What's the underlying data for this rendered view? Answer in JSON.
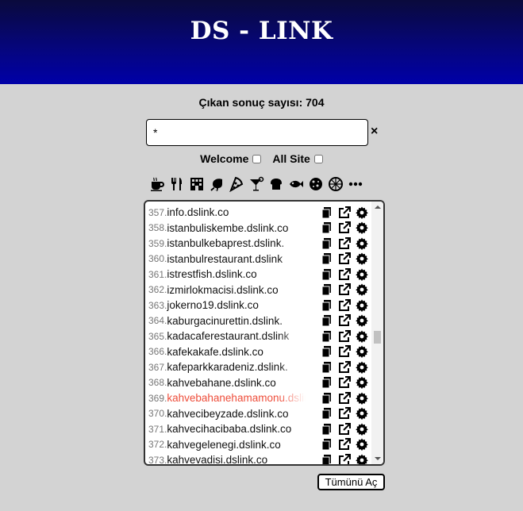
{
  "header": {
    "title": "DS - LINK"
  },
  "results": {
    "count_label": "Çıkan sonuç sayısı: 704"
  },
  "search": {
    "value": "*",
    "clear_label": "×"
  },
  "filters": {
    "welcome_label": "Welcome",
    "allsite_label": "All Site"
  },
  "categories": [
    "coffee-icon",
    "utensils-icon",
    "building-icon",
    "shrimp-icon",
    "pizza-icon",
    "cocktail-icon",
    "bread-icon",
    "fish-icon",
    "cookie-icon",
    "pie-icon",
    "more-icon"
  ],
  "colors": {
    "header_top": "#0a0a3c",
    "header_bottom": "#0000a8",
    "active_row": "#ee4d3a",
    "background": "#d3d3d3"
  },
  "list": {
    "rows": [
      {
        "num": "357.",
        "domain": "info.dslink.co"
      },
      {
        "num": "358.",
        "domain": "istanbuliskembe.dslink.co"
      },
      {
        "num": "359.",
        "domain": "istanbulkebaprest.dslink."
      },
      {
        "num": "360.",
        "domain": "istanbulrestaurant.dslink"
      },
      {
        "num": "361.",
        "domain": "istrestfish.dslink.co"
      },
      {
        "num": "362.",
        "domain": "izmirlokmacisi.dslink.co"
      },
      {
        "num": "363.",
        "domain": "jokerno19.dslink.co"
      },
      {
        "num": "364.",
        "domain": "kaburgacinurettin.dslink."
      },
      {
        "num": "365.",
        "domain": "kadacaferestaurant.dslink"
      },
      {
        "num": "366.",
        "domain": "kafekakafe.dslink.co"
      },
      {
        "num": "367.",
        "domain": "kafeparkkaradeniz.dslink."
      },
      {
        "num": "368.",
        "domain": "kahvebahane.dslink.co"
      },
      {
        "num": "369.",
        "domain": "kahvebahanehamamonu.dslin"
      },
      {
        "num": "370.",
        "domain": "kahvecibeyzade.dslink.co"
      },
      {
        "num": "371.",
        "domain": "kahvecihacibaba.dslink.co"
      },
      {
        "num": "372.",
        "domain": "kahvegelenegi.dslink.co"
      },
      {
        "num": "373.",
        "domain": "kahvevadisi.dslink.co"
      }
    ]
  },
  "footer": {
    "open_all_label": "Tümünü Aç"
  }
}
